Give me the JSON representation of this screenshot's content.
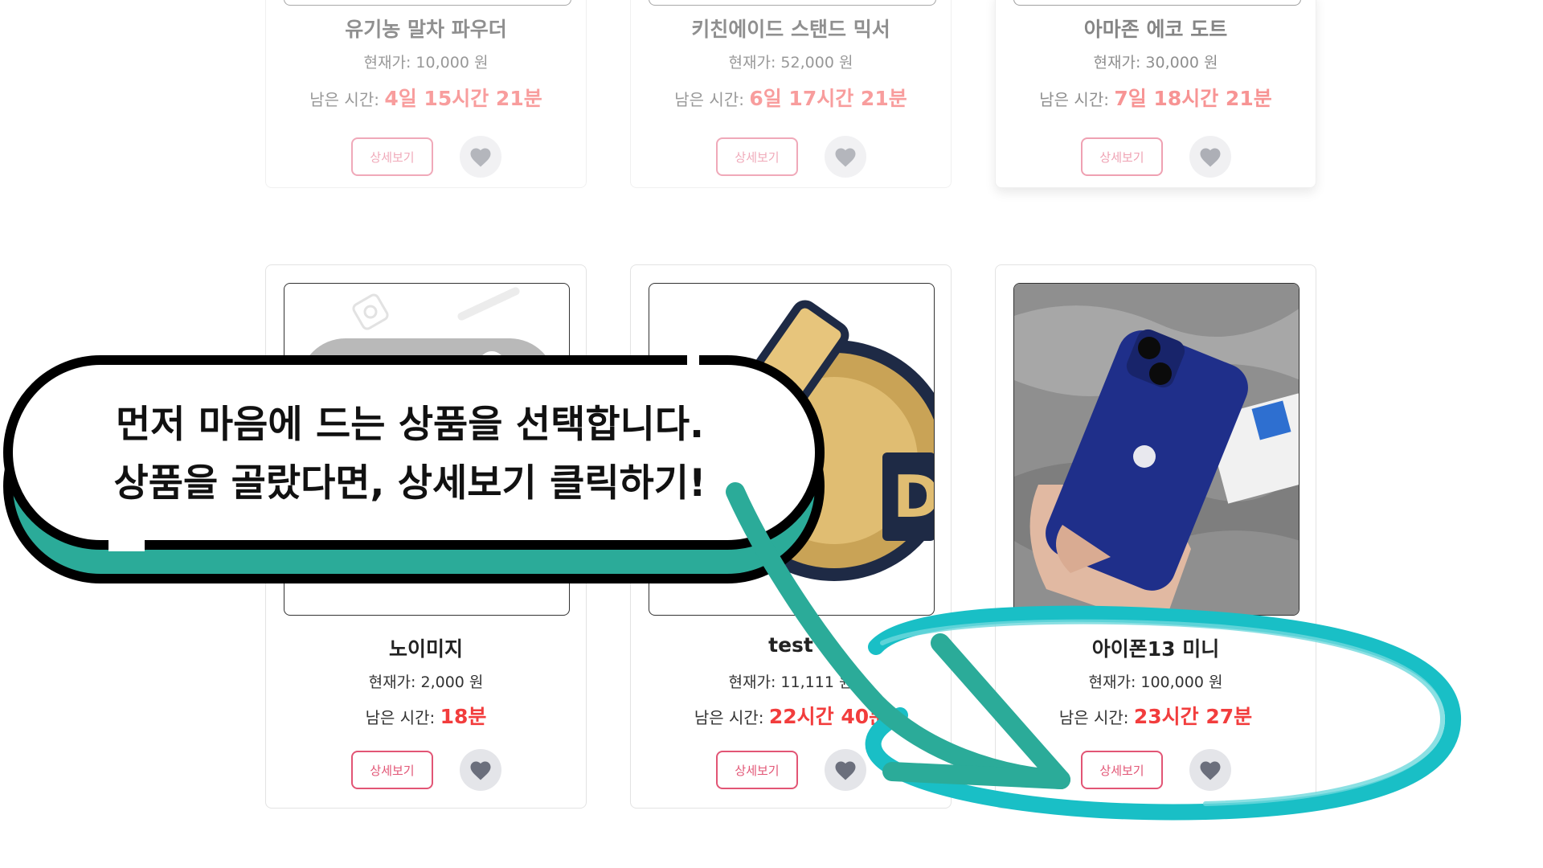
{
  "products_top": [
    {
      "name": "유기농 말차 파우더",
      "price": "현재가: 10,000 원",
      "time_label": "남은 시간:",
      "time_value": "4일 15시간 21분",
      "detail_label": "상세보기"
    },
    {
      "name": "키친에이드 스탠드 믹서",
      "price": "현재가: 52,000 원",
      "time_label": "남은 시간:",
      "time_value": "6일 17시간 21분",
      "detail_label": "상세보기"
    },
    {
      "name": "아마존 에코 도트",
      "price": "현재가: 30,000 원",
      "time_label": "남은 시간:",
      "time_value": "7일 18시간 21분",
      "detail_label": "상세보기"
    }
  ],
  "products_bottom": [
    {
      "name": "노이미지",
      "price": "현재가: 2,000 원",
      "time_label": "남은 시간:",
      "time_value": "18분",
      "detail_label": "상세보기",
      "image": "no-image-placeholder"
    },
    {
      "name": "test",
      "price": "현재가: 11,111 원",
      "time_label": "남은 시간:",
      "time_value": "22시간 40분",
      "detail_label": "상세보기",
      "image": "gold-logo-badge"
    },
    {
      "name": "아이폰13 미니",
      "price": "현재가: 100,000 원",
      "time_label": "남은 시간:",
      "time_value": "23시간 27분",
      "detail_label": "상세보기",
      "image": "blue-iphone-in-hand"
    }
  ],
  "callout": {
    "line1": "먼저 마음에 드는 상품을 선택합니다.",
    "line2": "상품을 골랐다면, 상세보기 클릭하기!"
  },
  "colors": {
    "accent_pink": "#e25575",
    "time_red": "#f23d3d",
    "callout_shadow": "#2bab99",
    "circle_teal": "#19bfc6",
    "heart_bg": "#e4e5e9",
    "heart_icon": "#6b6f7c"
  },
  "icons": {
    "favorite": "heart-icon"
  }
}
